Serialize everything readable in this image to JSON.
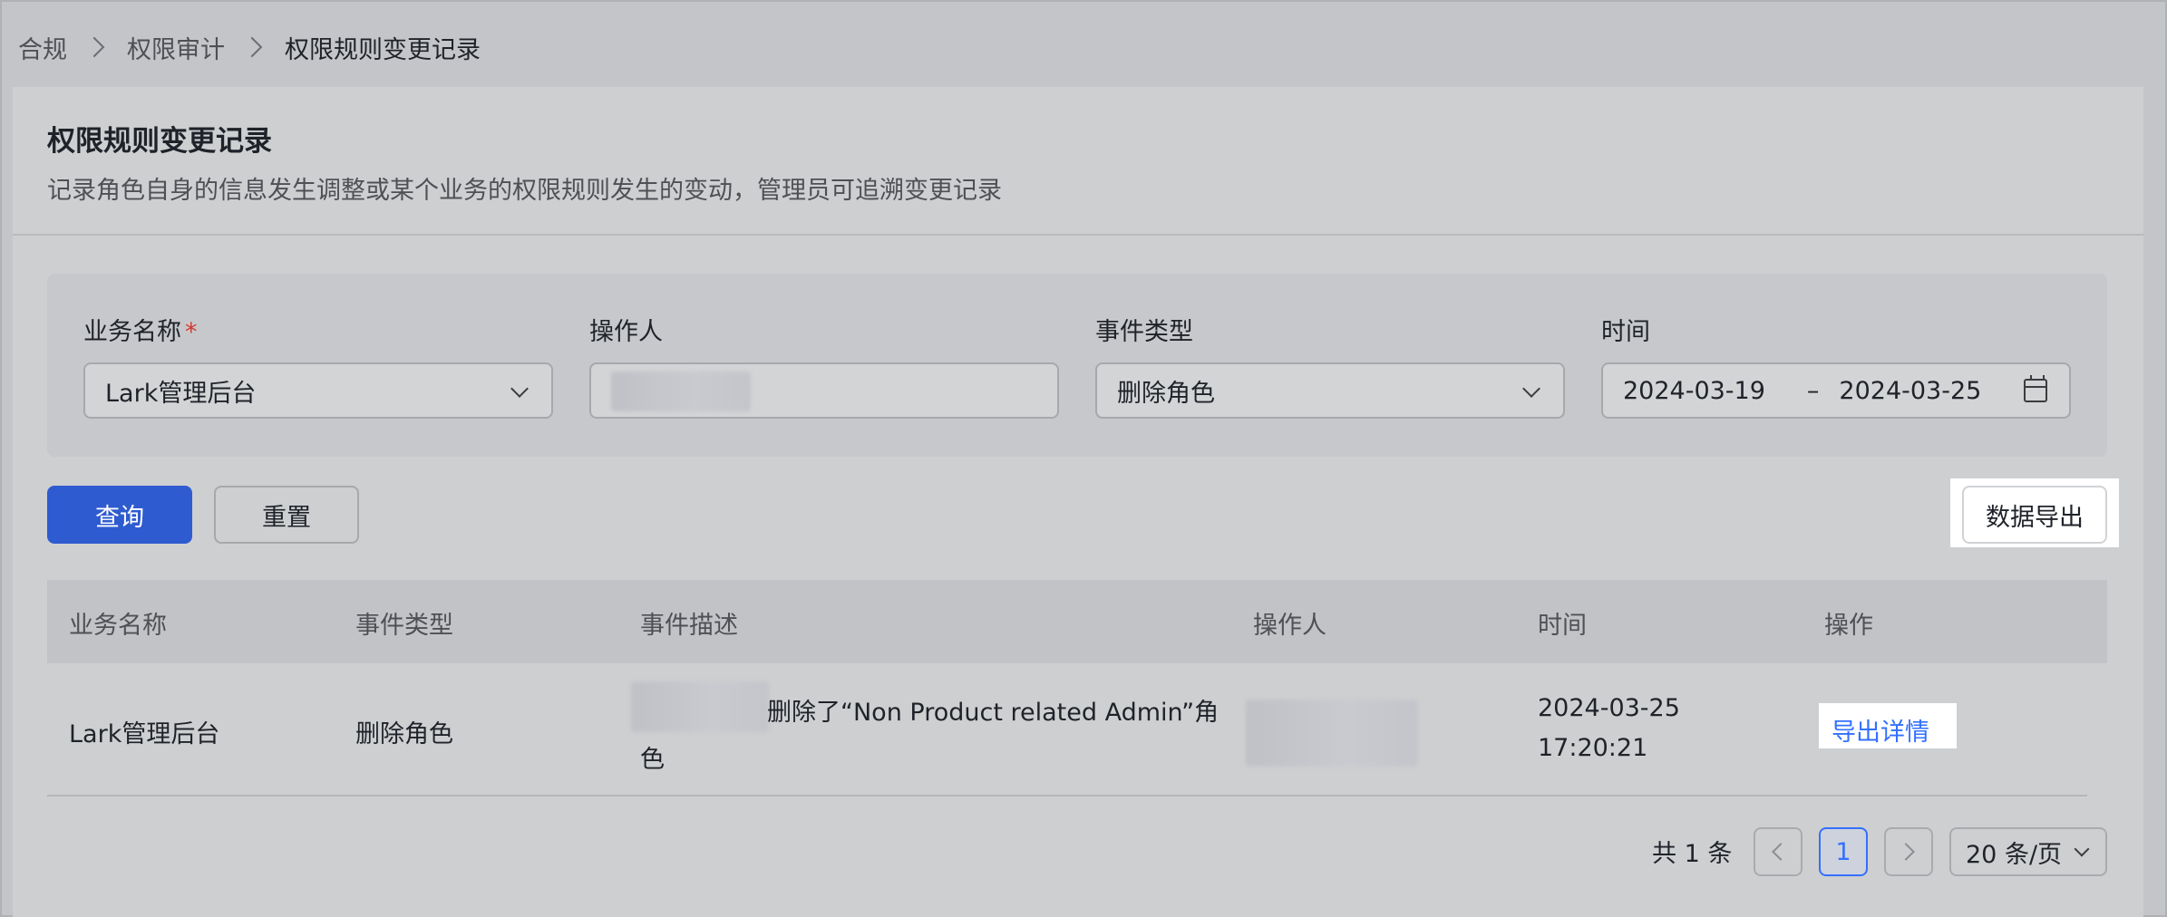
{
  "breadcrumb": {
    "items": [
      "合规",
      "权限审计",
      "权限规则变更记录"
    ]
  },
  "header": {
    "title": "权限规则变更记录",
    "description": "记录角色自身的信息发生调整或某个业务的权限规则发生的变动，管理员可追溯变更记录"
  },
  "filters": {
    "business": {
      "label": "业务名称",
      "required_mark": "*",
      "value": "Lark管理后台"
    },
    "operator": {
      "label": "操作人",
      "value": ""
    },
    "event_type": {
      "label": "事件类型",
      "value": "删除角色"
    },
    "time": {
      "label": "时间",
      "start": "2024-03-19",
      "separator": "–",
      "end": "2024-03-25"
    }
  },
  "actions": {
    "query": "查询",
    "reset": "重置",
    "export": "数据导出"
  },
  "table": {
    "headers": [
      "业务名称",
      "事件类型",
      "事件描述",
      "操作人",
      "时间",
      "操作"
    ],
    "rows": [
      {
        "business": "Lark管理后台",
        "event_type": "删除角色",
        "description_line1": "删除了“Non Product related Admin”角",
        "description_line2": "色",
        "date": "2024-03-25",
        "time": "17:20:21",
        "action": "导出详情"
      }
    ]
  },
  "pagination": {
    "total": "共 1 条",
    "current_page": "1",
    "page_size": "20 条/页"
  },
  "colors": {
    "primary": "#2f5bd0",
    "link": "#3370ff",
    "required": "#d23b2e"
  }
}
